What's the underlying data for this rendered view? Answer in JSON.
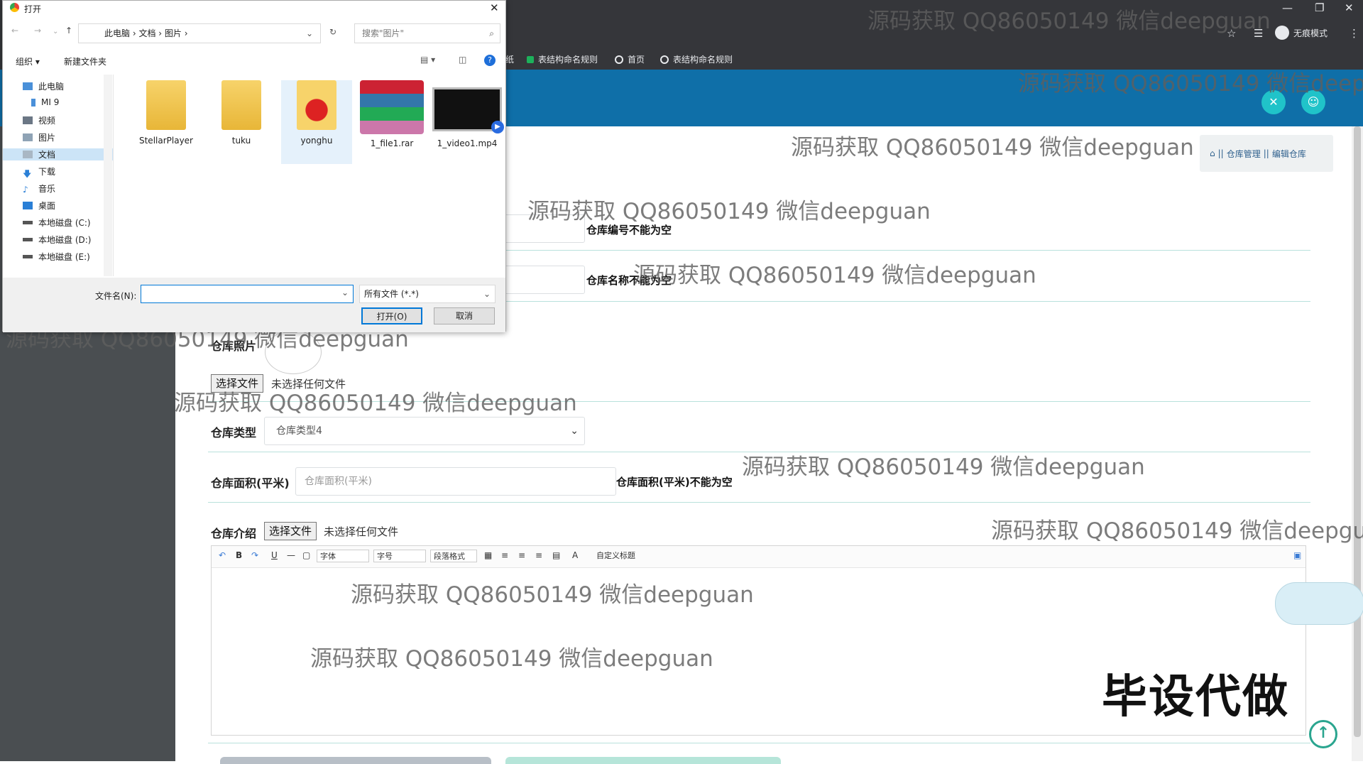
{
  "browser": {
    "bookmarks": [
      {
        "label": "纸"
      },
      {
        "label": "表结构命名规则"
      },
      {
        "label": "首页"
      },
      {
        "label": "表结构命名规则"
      }
    ],
    "incognito_label": "无痕模式"
  },
  "breadcrumb": {
    "sep": "||",
    "items": [
      "仓库管理",
      "编辑仓库"
    ]
  },
  "form": {
    "code_error": "仓库编号不能为空",
    "name_error": "仓库名称不能为空",
    "photo_label": "仓库照片",
    "photo_file_button": "选择文件",
    "photo_file_status": "未选择任何文件",
    "type_label": "仓库类型",
    "type_value": "仓库类型4",
    "area_label": "仓库面积(平米)",
    "area_placeholder": "仓库面积(平米)",
    "area_error": "仓库面积(平米)不能为空",
    "intro_label": "仓库介绍",
    "intro_file_button": "选择文件",
    "intro_file_status": "未选择任何文件"
  },
  "editor_toolbar": {
    "bold": "B",
    "underline": "U",
    "font_family": "字体",
    "font_size": "字号",
    "paragraph": "段落格式",
    "font_color": "A",
    "custom_title": "自定义标题"
  },
  "dialog": {
    "title": "打开",
    "path": [
      "此电脑",
      "文档",
      "图片"
    ],
    "search_placeholder": "搜索\"图片\"",
    "organize": "组织 ▾",
    "new_folder": "新建文件夹",
    "sidebar": [
      {
        "label": "此电脑",
        "icon": "computer-icon"
      },
      {
        "label": "MI 9",
        "icon": "phone-icon"
      },
      {
        "label": "视频",
        "icon": "video-folder-icon"
      },
      {
        "label": "图片",
        "icon": "picture-folder-icon"
      },
      {
        "label": "文档",
        "icon": "document-folder-icon"
      },
      {
        "label": "下载",
        "icon": "download-icon"
      },
      {
        "label": "音乐",
        "icon": "music-icon"
      },
      {
        "label": "桌面",
        "icon": "desktop-icon"
      },
      {
        "label": "本地磁盘 (C:)",
        "icon": "drive-icon"
      },
      {
        "label": "本地磁盘 (D:)",
        "icon": "drive-icon"
      },
      {
        "label": "本地磁盘 (E:)",
        "icon": "drive-icon"
      }
    ],
    "files": [
      {
        "name": "StellarPlayer",
        "kind": "folder"
      },
      {
        "name": "tuku",
        "kind": "folder"
      },
      {
        "name": "yonghu",
        "kind": "folder"
      },
      {
        "name": "1_file1.rar",
        "kind": "rar"
      },
      {
        "name": "1_video1.mp4",
        "kind": "video"
      }
    ],
    "filename_label": "文件名(N):",
    "filename_value": "",
    "filetype_value": "所有文件 (*.*)",
    "open_button": "打开(O)",
    "cancel_button": "取消"
  },
  "watermark": "源码获取 QQ86050149 微信deepguan",
  "watermark_partial_1": "源码获取 QQ86050149 微信deepgu",
  "watermark_partial_2": "源码获取 QQ86050149 微信deepgua",
  "overlay_text": "毕设代做",
  "colors": {
    "header": "#0f6fa8",
    "accent": "#20c3c9",
    "divider": "#b9e1dc"
  }
}
